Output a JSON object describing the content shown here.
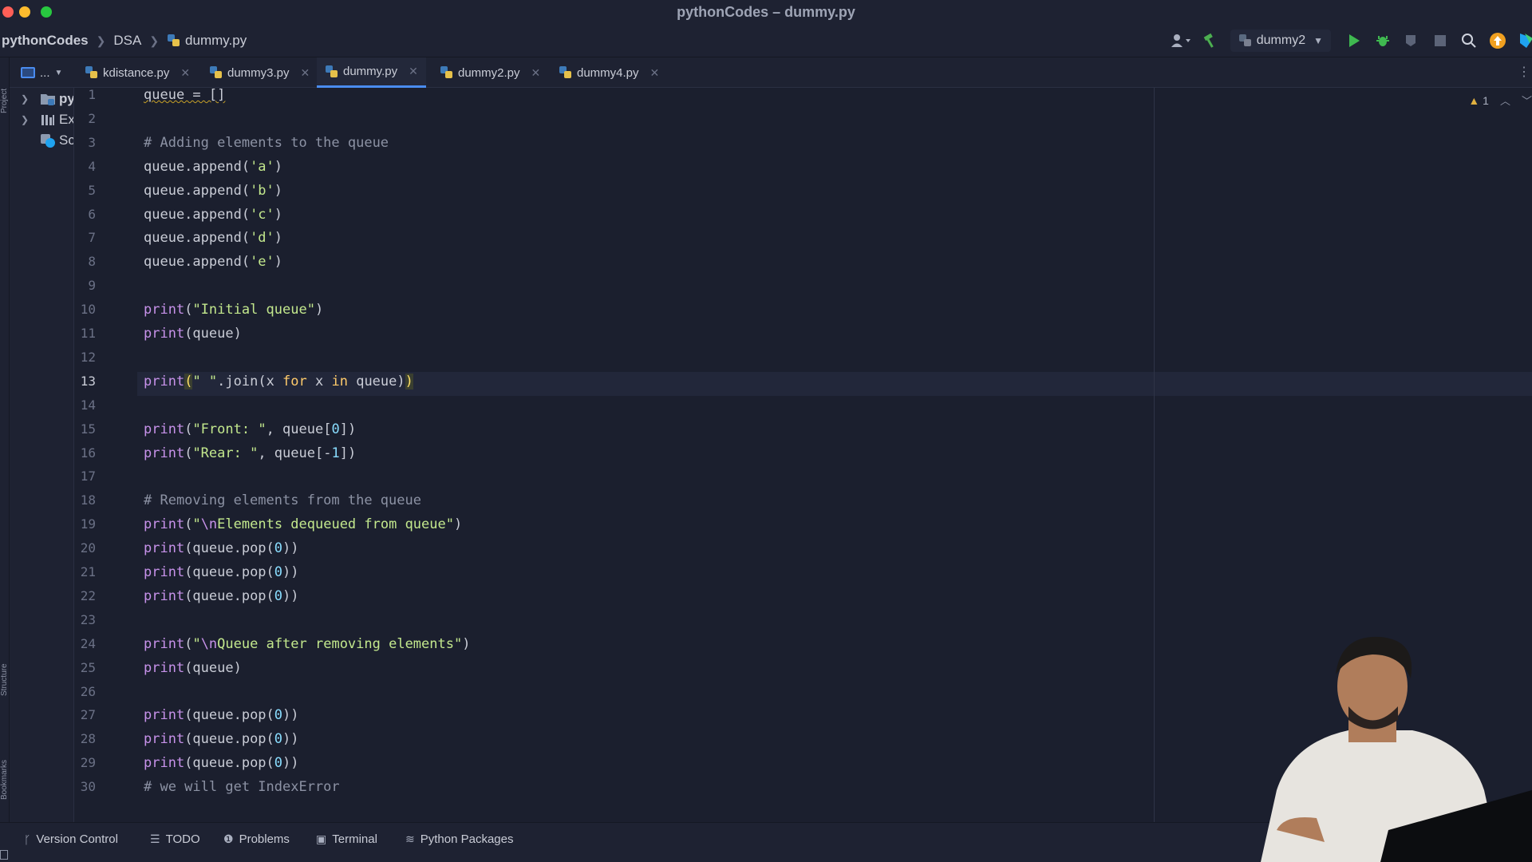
{
  "window": {
    "title": "pythonCodes – dummy.py"
  },
  "breadcrumb": {
    "project": "pythonCodes",
    "folder": "DSA",
    "file": "dummy.py"
  },
  "toolbar": {
    "run_config": "dummy2"
  },
  "tabs": [
    {
      "label": "kdistance.py",
      "active": false
    },
    {
      "label": "dummy3.py",
      "active": false
    },
    {
      "label": "dummy.py",
      "active": true
    },
    {
      "label": "dummy2.py",
      "active": false
    },
    {
      "label": "dummy4.py",
      "active": false
    }
  ],
  "project_panel": {
    "toggle_label": "...",
    "items": [
      {
        "label": "py"
      },
      {
        "label": "Ex"
      },
      {
        "label": "Sc"
      }
    ]
  },
  "tool_strip": {
    "top": "Project",
    "middle": "Structure",
    "bottom": "Bookmarks"
  },
  "editor": {
    "current_line": 13,
    "inspection_count": "1",
    "lines": [
      "queue = []",
      "",
      "# Adding elements to the queue",
      "queue.append('a')",
      "queue.append('b')",
      "queue.append('c')",
      "queue.append('d')",
      "queue.append('e')",
      "",
      "print(\"Initial queue\")",
      "print(queue)",
      "",
      "print(\" \".join(x for x in queue))",
      "",
      "print(\"Front: \", queue[0])",
      "print(\"Rear: \", queue[-1])",
      "",
      "# Removing elements from the queue",
      "print(\"\\nElements dequeued from queue\")",
      "print(queue.pop(0))",
      "print(queue.pop(0))",
      "print(queue.pop(0))",
      "",
      "print(\"\\nQueue after removing elements\")",
      "print(queue)",
      "",
      "print(queue.pop(0))",
      "print(queue.pop(0))",
      "print(queue.pop(0))",
      "# we will get IndexError"
    ]
  },
  "bottom_tools": [
    {
      "label": "Version Control",
      "icon": "branch-icon"
    },
    {
      "label": "TODO",
      "icon": "list-icon"
    },
    {
      "label": "Problems",
      "icon": "info-icon"
    },
    {
      "label": "Terminal",
      "icon": "terminal-icon"
    },
    {
      "label": "Python Packages",
      "icon": "layers-icon"
    }
  ],
  "colors": {
    "background": "#1b1f2e",
    "accent": "#4a8cf0",
    "run": "#3fb950",
    "string": "#c3e88d",
    "keyword": "#c792ea"
  }
}
